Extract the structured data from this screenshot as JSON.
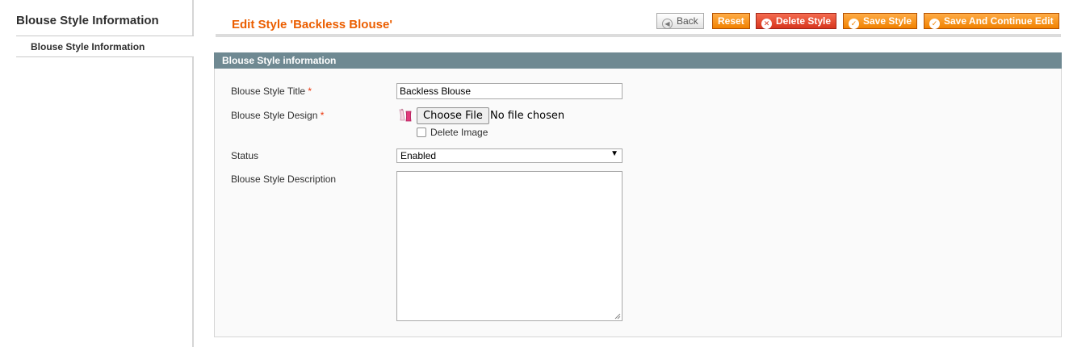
{
  "sidebar": {
    "title": "Blouse Style Information",
    "tabs": [
      {
        "label": "Blouse Style Information"
      }
    ]
  },
  "header": {
    "title": "Edit Style 'Backless Blouse'"
  },
  "toolbar": {
    "back_label": "Back",
    "reset_label": "Reset",
    "delete_label": "Delete Style",
    "save_label": "Save Style",
    "save_continue_label": "Save And Continue Edit"
  },
  "form": {
    "section_title": "Blouse Style information",
    "required_marker": "*",
    "fields": {
      "title": {
        "label": "Blouse Style Title",
        "value": "Backless Blouse"
      },
      "design": {
        "label": "Blouse Style Design",
        "choose_label": "Choose File",
        "file_status": "No file chosen",
        "delete_label": "Delete Image",
        "delete_checked": false
      },
      "status": {
        "label": "Status",
        "selected": "Enabled"
      },
      "description": {
        "label": "Blouse Style Description",
        "value": ""
      }
    }
  },
  "colors": {
    "accent": "#eb5e00",
    "button_orange": "#f18200",
    "button_delete": "#d8361e",
    "section_header": "#6f8992"
  }
}
